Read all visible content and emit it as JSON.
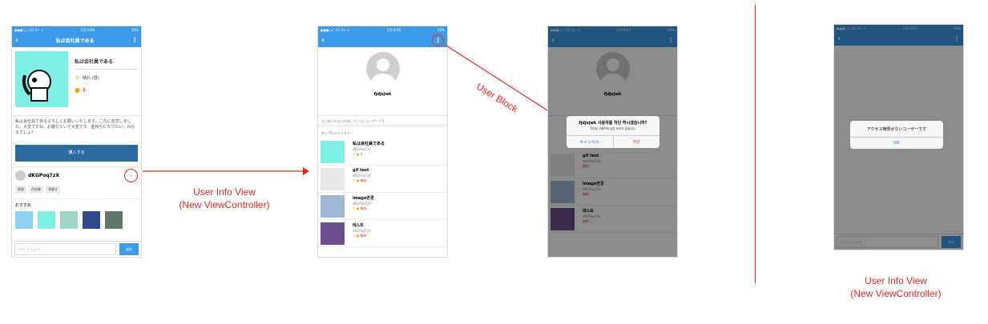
{
  "phone1": {
    "status": {
      "carrier": "●●●○○ LG U+ ᯤ",
      "time": "오전 8:66",
      "battery": "63%"
    },
    "nav_title": "私は会社員である",
    "post_title": "私は会社員である",
    "weather": "晴れ (昼)",
    "likes": "3",
    "description": "私は会社員であるよろしくお願いいたします。これに苦労しました。大変ですね。お腹もすいて大変です。金持ちになりたい。わかるでしょ？",
    "buy_label": "購入する",
    "username": "dKGPoq7zX",
    "tags": [
      "朝暮",
      "色絵筆",
      "落書き"
    ],
    "reco_title": "おすすめ",
    "comment_placeholder": "コメントしよう",
    "send_label": "送信"
  },
  "caption1": {
    "line1": "User Info View",
    "line2": "(New ViewController)"
  },
  "phone2": {
    "status": {
      "carrier": "●●●○○ LG U+ ᯤ",
      "time": "오전 8:66",
      "battery": "63%"
    },
    "name": "fjdjsjwk",
    "intro": "自己紹介をまだ作成していないユーザーです",
    "list_title": "アップロードリスト",
    "items": [
      {
        "title": "私は会社員である",
        "user": "dKGPoq7zX",
        "price": "3"
      },
      {
        "title": "gif test",
        "user": "dKGPoq7zX",
        "price": "無料"
      },
      {
        "title": "image변경",
        "user": "dKGPoq7zX",
        "price": "無料"
      },
      {
        "title": "테스트",
        "user": "dKGPoq7zX",
        "price": "無料"
      }
    ]
  },
  "arrow_label": "User Block",
  "phone3": {
    "status": {
      "carrier": "●●●○○ LG U+ ᯤ",
      "time": "오전 8:67",
      "battery": "63%"
    },
    "name": "fjdjsjwk",
    "items": [
      {
        "title": "gif test",
        "user": "dKGPoq7zX",
        "price": "無料"
      },
      {
        "title": "image변경",
        "user": "dKGPoq7zX",
        "price": "無料"
      },
      {
        "title": "테스트",
        "user": "dKGPoq7zX",
        "price": "無料"
      }
    ],
    "dialog": {
      "title": "fjdjsjwk 사용자를 차단 하시겠습니까?",
      "message": "차단된 사용자의 글은 보이지 않습니다.",
      "cancel": "キャンセル",
      "confirm": "차단"
    }
  },
  "phone4": {
    "status": {
      "carrier": "●●●○○ LG U+ ᯤ",
      "time": "오전 8:67",
      "battery": "63%"
    },
    "dialog": {
      "message": "アクセス権限がないユーザーです",
      "ok": "OK"
    },
    "comment_placeholder": "コメントしよう",
    "send_label": "送信"
  },
  "caption2": {
    "line1": "User Info View",
    "line2": "(New ViewController)"
  },
  "colors": {
    "accent": "#3c9be8",
    "annotation": "#e8281e",
    "buy": "#2c6aa0"
  }
}
